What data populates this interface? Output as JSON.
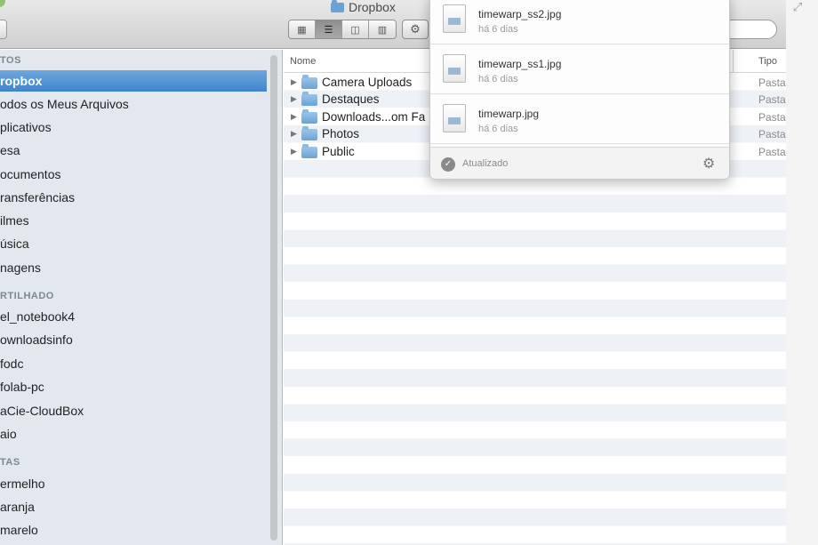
{
  "window": {
    "title": "Dropbox",
    "search_value": "",
    "view_buttons": [
      "icon-view-icon",
      "list-view-icon",
      "column-view-icon",
      "coverflow-view-icon"
    ],
    "active_view": 1
  },
  "sidebar": {
    "sections": [
      {
        "label": "TOS",
        "top": 0
      },
      {
        "label": "RTILHADO",
        "top": 0
      },
      {
        "label": "TAS",
        "top": 0
      }
    ],
    "favorites": [
      {
        "label": "ropbox",
        "selected": true
      },
      {
        "label": "odos os Meus Arquivos"
      },
      {
        "label": "plicativos"
      },
      {
        "label": "esa"
      },
      {
        "label": "ocumentos"
      },
      {
        "label": "ransferências"
      },
      {
        "label": "ilmes"
      },
      {
        "label": "úsica"
      },
      {
        "label": "nagens"
      }
    ],
    "shared": [
      {
        "label": "el_notebook4"
      },
      {
        "label": "ownloadsinfo"
      },
      {
        "label": "fodc"
      },
      {
        "label": "folab-pc"
      },
      {
        "label": "aCie-CloudBox"
      },
      {
        "label": "aio"
      }
    ],
    "tags": [
      {
        "label": "ermelho"
      },
      {
        "label": "aranja"
      },
      {
        "label": "marelo"
      }
    ]
  },
  "list": {
    "col_name": "Nome",
    "col_type": "Tipo",
    "rows": [
      {
        "name": "Camera Uploads",
        "type": "Pasta"
      },
      {
        "name": "Destaques",
        "type": "Pasta"
      },
      {
        "name": "Downloads...om Fa",
        "type": "Pasta"
      },
      {
        "name": "Photos",
        "type": "Pasta"
      },
      {
        "name": "Public",
        "type": "Pasta"
      }
    ]
  },
  "popover": {
    "items": [
      {
        "name": "timewarp_ss2.jpg",
        "time": "há 6 dias"
      },
      {
        "name": "timewarp_ss1.jpg",
        "time": "há 6 dias"
      },
      {
        "name": "timewarp.jpg",
        "time": "há 6 dias"
      }
    ],
    "status": "Atualizado"
  },
  "colors": {
    "selection": "#3f84cc",
    "sidebar_bg": "#e3e8ee",
    "stripe": "#eef2f7"
  }
}
